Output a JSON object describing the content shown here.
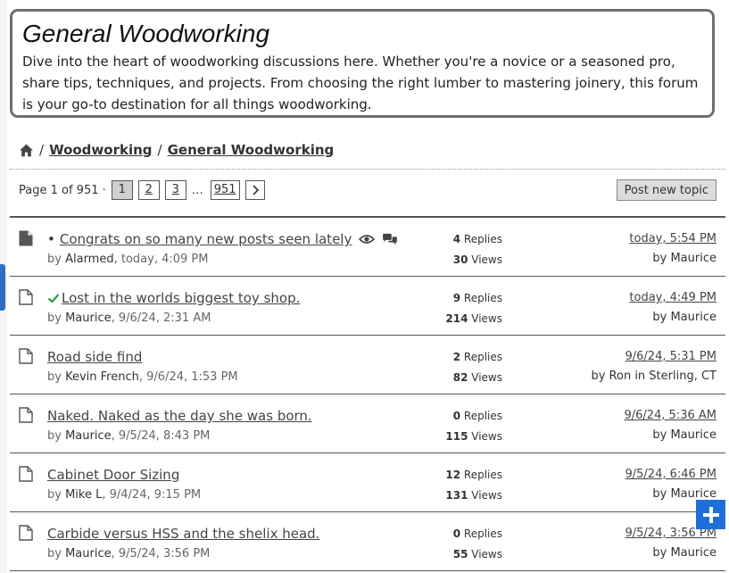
{
  "forum": {
    "title": "General Woodworking",
    "description": "Dive into the heart of woodworking discussions here. Whether you're a novice or a seasoned pro, share tips, techniques, and projects. From choosing the right lumber to mastering joinery, this forum is your go-to destination for all things woodworking."
  },
  "breadcrumb": {
    "separator": "/",
    "items": [
      "Woodworking",
      "General Woodworking"
    ]
  },
  "pagination": {
    "label": "Page 1 of 951 ·",
    "pages": [
      "1",
      "2",
      "3"
    ],
    "ellipsis": "…",
    "last_page": "951",
    "current_page": "1",
    "post_button": "Post new topic"
  },
  "stats_labels": {
    "replies": "Replies",
    "views": "Views"
  },
  "topics": [
    {
      "title": "Congrats on so many new posts seen lately",
      "bullet": "•",
      "author_prefix": "by",
      "author": "Alarmed",
      "date": ", today, 4:09 PM",
      "replies": "4",
      "views": "30",
      "last_time": "today, 5:54 PM",
      "last_prefix": "by",
      "last_author": "Maurice"
    },
    {
      "title": "Lost in the worlds biggest toy shop.",
      "author_prefix": "by",
      "author": "Maurice",
      "date": ", 9/6/24, 2:31 AM",
      "replies": "9",
      "views": "214",
      "last_time": "today, 4:49 PM",
      "last_prefix": "by",
      "last_author": "Maurice"
    },
    {
      "title": "Road side find",
      "author_prefix": "by",
      "author": "Kevin French",
      "date": ", 9/6/24, 1:53 PM",
      "replies": "2",
      "views": "82",
      "last_time": "9/6/24, 5:31 PM",
      "last_prefix": "by",
      "last_author": "Ron in Sterling, CT"
    },
    {
      "title": "Naked. Naked as the day she was born.",
      "author_prefix": "by",
      "author": "Maurice",
      "date": ", 9/5/24, 8:43 PM",
      "replies": "0",
      "views": "115",
      "last_time": "9/6/24, 5:36 AM",
      "last_prefix": "by",
      "last_author": "Maurice"
    },
    {
      "title": "Cabinet Door Sizing",
      "author_prefix": "by",
      "author": "Mike L",
      "date": ", 9/4/24, 9:15 PM",
      "replies": "12",
      "views": "131",
      "last_time": "9/5/24, 6:46 PM",
      "last_prefix": "by",
      "last_author": "Maurice"
    },
    {
      "title": "Carbide versus HSS and the shelix head.",
      "author_prefix": "by",
      "author": "Maurice",
      "date": ", 9/5/24, 3:56 PM",
      "replies": "0",
      "views": "55",
      "last_time": "9/5/24, 3:56 PM",
      "last_prefix": "by",
      "last_author": "Maurice"
    }
  ],
  "icons": {
    "home": "home-icon",
    "topic": "document-icon",
    "solved": "check-icon",
    "watched": "eye-icon",
    "participated": "chat-bubbles-icon",
    "next": "chevron-right-icon",
    "share": "plus-icon"
  },
  "colors": {
    "border": "#6f6f6f",
    "solved_check": "#2e9e3e",
    "share_button": "#1e6fd9",
    "active_page": "#cfcfcf"
  }
}
